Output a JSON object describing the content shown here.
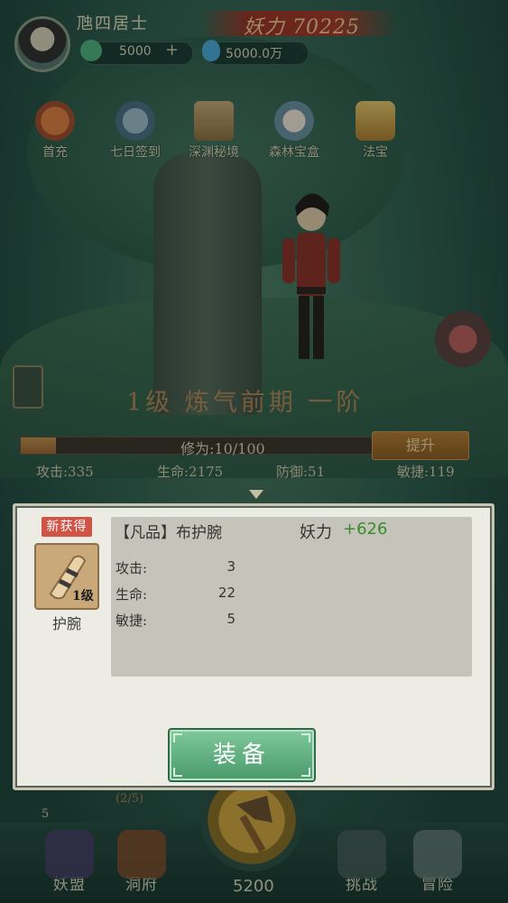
{
  "header": {
    "player_name": "虺四居士",
    "power_label": "妖力 70225",
    "resource1_value": "5000",
    "resource1_add": "+",
    "resource2_value": "5000.0万"
  },
  "features": [
    {
      "label": "首充",
      "icon": "gourd-icon"
    },
    {
      "label": "七日签到",
      "icon": "clock-icon"
    },
    {
      "label": "深渊秘境",
      "icon": "book-icon"
    },
    {
      "label": "森林宝盒",
      "icon": "fox-icon"
    },
    {
      "label": "法宝",
      "icon": "crown-icon"
    }
  ],
  "stage": {
    "level_text": "1级 炼气前期 一阶"
  },
  "cultivation": {
    "progress_text": "修为:10/100",
    "progress_fraction": 0.1,
    "breakthrough_label": "提升"
  },
  "stats": [
    {
      "text": "攻击:335"
    },
    {
      "text": "生命:2175"
    },
    {
      "text": "防御:51"
    },
    {
      "text": "敏捷:119"
    }
  ],
  "bottom": {
    "small_progress": "(2/5)",
    "badge_count": "5",
    "main_count": "5200",
    "nav": [
      {
        "label": "妖盟",
        "icon": "demon-icon"
      },
      {
        "label": "洞府",
        "icon": "gate-icon"
      },
      {
        "label": "挑战",
        "icon": "cannon-icon"
      },
      {
        "label": "冒险",
        "icon": "mountain-icon"
      }
    ]
  },
  "modal": {
    "new_badge": "新获得",
    "item_title": "【凡品】布护腕",
    "power_label": "妖力",
    "power_bonus": "+626",
    "item_level": "1级",
    "item_type": "护腕",
    "attributes": [
      {
        "label": "攻击:",
        "value": "3"
      },
      {
        "label": "生命:",
        "value": "22"
      },
      {
        "label": "敏捷:",
        "value": "5"
      }
    ],
    "equip_label": "装备"
  }
}
